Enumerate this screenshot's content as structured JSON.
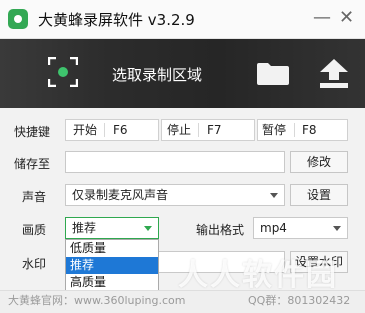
{
  "window": {
    "title": "大黄蜂录屏软件 v3.2.9",
    "minimize_label": "—",
    "close_label": "✕"
  },
  "toolbar": {
    "select_region_label": "选取录制区域",
    "icons": [
      "region-select-icon",
      "folder-icon",
      "upload-icon"
    ]
  },
  "hotkeys": {
    "label": "快捷键",
    "items": [
      {
        "name": "开始",
        "key": "F6"
      },
      {
        "name": "停止",
        "key": "F7"
      },
      {
        "name": "暂停",
        "key": "F8"
      }
    ]
  },
  "save": {
    "label": "储存至",
    "path": "",
    "button": "修改"
  },
  "sound": {
    "label": "声音",
    "selected": "仅录制麦克风声音",
    "button": "设置"
  },
  "quality": {
    "label": "画质",
    "selected": "推荐",
    "options": [
      "低质量",
      "推荐",
      "高质量"
    ]
  },
  "format": {
    "label": "输出格式",
    "selected": "mp4"
  },
  "watermark": {
    "label": "水印",
    "button": "设置水印"
  },
  "footer": {
    "website": "大黄蜂官网：www.360luping.com",
    "qq_group": "QQ群：801302432"
  },
  "overlay": {
    "watermark_text": "人人软件园"
  },
  "colors": {
    "accent": "#33a854",
    "dropdown_highlight": "#1e78d6",
    "toolbar_bg": "#2c2c2c"
  }
}
